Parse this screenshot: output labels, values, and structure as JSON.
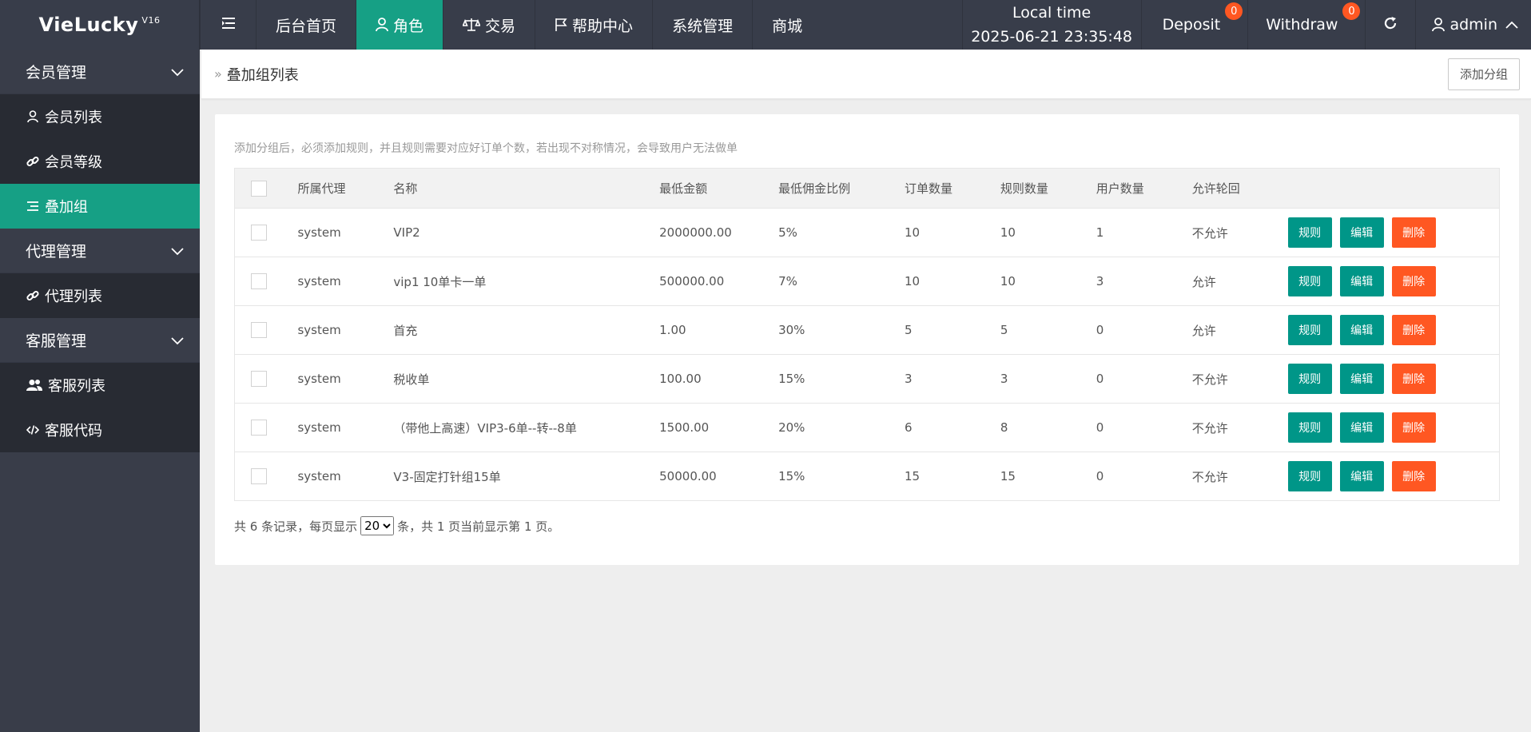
{
  "logo": {
    "name": "VieLucky",
    "version": "V16"
  },
  "topnav": [
    {
      "label": "后台首页",
      "icon": "",
      "active": false
    },
    {
      "label": "角色",
      "icon": "user-icon",
      "active": true
    },
    {
      "label": "交易",
      "icon": "scale-icon",
      "active": false
    },
    {
      "label": "帮助中心",
      "icon": "flag-icon",
      "active": false
    },
    {
      "label": "系统管理",
      "icon": "",
      "active": false
    },
    {
      "label": "商城",
      "icon": "",
      "active": false
    }
  ],
  "time": {
    "label": "Local time",
    "value": "2025-06-21 23:35:48"
  },
  "deposit": {
    "label": "Deposit",
    "count": "0"
  },
  "withdraw": {
    "label": "Withdraw",
    "count": "0"
  },
  "user": {
    "name": "admin"
  },
  "sidebar": {
    "groups": [
      {
        "label": "会员管理",
        "items": [
          {
            "label": "会员列表",
            "icon": "user-icon"
          },
          {
            "label": "会员等级",
            "icon": "link-icon"
          },
          {
            "label": "叠加组",
            "icon": "list-icon",
            "active": true
          }
        ]
      },
      {
        "label": "代理管理",
        "items": [
          {
            "label": "代理列表",
            "icon": "link-icon"
          }
        ]
      },
      {
        "label": "客服管理",
        "items": [
          {
            "label": "客服列表",
            "icon": "users-icon"
          },
          {
            "label": "客服代码",
            "icon": "code-icon"
          }
        ]
      }
    ]
  },
  "breadcrumb": "叠加组列表",
  "add_group_label": "添加分组",
  "hint": "添加分组后，必须添加规则，并且规则需要对应好订单个数，若出现不对称情况，会导致用户无法做单",
  "table": {
    "headers": [
      "所属代理",
      "名称",
      "最低金额",
      "最低佣金比例",
      "订单数量",
      "规则数量",
      "用户数量",
      "允许轮回"
    ],
    "rows": [
      {
        "agent": "system",
        "name": "VIP2",
        "min_amount": "2000000.00",
        "min_rate": "5%",
        "orders": "10",
        "rules": "10",
        "users": "1",
        "loop": "不允许"
      },
      {
        "agent": "system",
        "name": "vip1 10单卡一单",
        "min_amount": "500000.00",
        "min_rate": "7%",
        "orders": "10",
        "rules": "10",
        "users": "3",
        "loop": "允许"
      },
      {
        "agent": "system",
        "name": "首充",
        "min_amount": "1.00",
        "min_rate": "30%",
        "orders": "5",
        "rules": "5",
        "users": "0",
        "loop": "允许"
      },
      {
        "agent": "system",
        "name": "税收单",
        "min_amount": "100.00",
        "min_rate": "15%",
        "orders": "3",
        "rules": "3",
        "users": "0",
        "loop": "不允许"
      },
      {
        "agent": "system",
        "name": "（带他上高速）VIP3-6单--转--8单",
        "min_amount": "1500.00",
        "min_rate": "20%",
        "orders": "6",
        "rules": "8",
        "users": "0",
        "loop": "不允许"
      },
      {
        "agent": "system",
        "name": "V3-固定打针组15单",
        "min_amount": "50000.00",
        "min_rate": "15%",
        "orders": "15",
        "rules": "15",
        "users": "0",
        "loop": "不允许"
      }
    ],
    "actions": {
      "rule": "规则",
      "edit": "编辑",
      "delete": "删除"
    }
  },
  "pager": {
    "prefix": "共 6 条记录，每页显示",
    "page_size": "20",
    "suffix": "条，共 1 页当前显示第 1 页。"
  },
  "colors": {
    "topbar": "#383d4a",
    "sidebar": "#393d49",
    "sub": "#282b33",
    "accent": "#16a085",
    "green_btn": "#009688",
    "red_btn": "#ff5722"
  }
}
